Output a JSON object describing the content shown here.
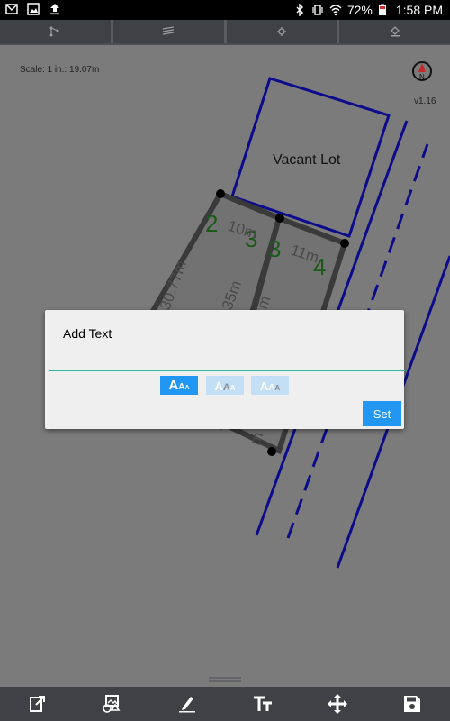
{
  "status_bar": {
    "battery": "72%",
    "time": "1:58 PM"
  },
  "toolbar": {
    "buttons": [
      "vertex-tool",
      "layers-tool",
      "settings-tool",
      "fill-tool"
    ]
  },
  "map": {
    "scale_text": "Scale: 1 in.: 19.07m",
    "version": "v1.16",
    "compass_letter": "N",
    "vacant_lot_label": "Vacant Lot",
    "lot_numbers": [
      "2",
      "3",
      "3",
      "4"
    ],
    "edge_labels": [
      "10m",
      "11m",
      "30.77m",
      "35m",
      "m",
      "m"
    ]
  },
  "dialog": {
    "title": "Add Text",
    "input_value": "",
    "size_options": [
      "AAA",
      "AAA",
      "AAA"
    ],
    "selected_size": 0,
    "set_label": "Set"
  },
  "bottom_bar": {
    "buttons": [
      "export",
      "view-toggle",
      "edit",
      "text-size",
      "move",
      "save"
    ]
  }
}
